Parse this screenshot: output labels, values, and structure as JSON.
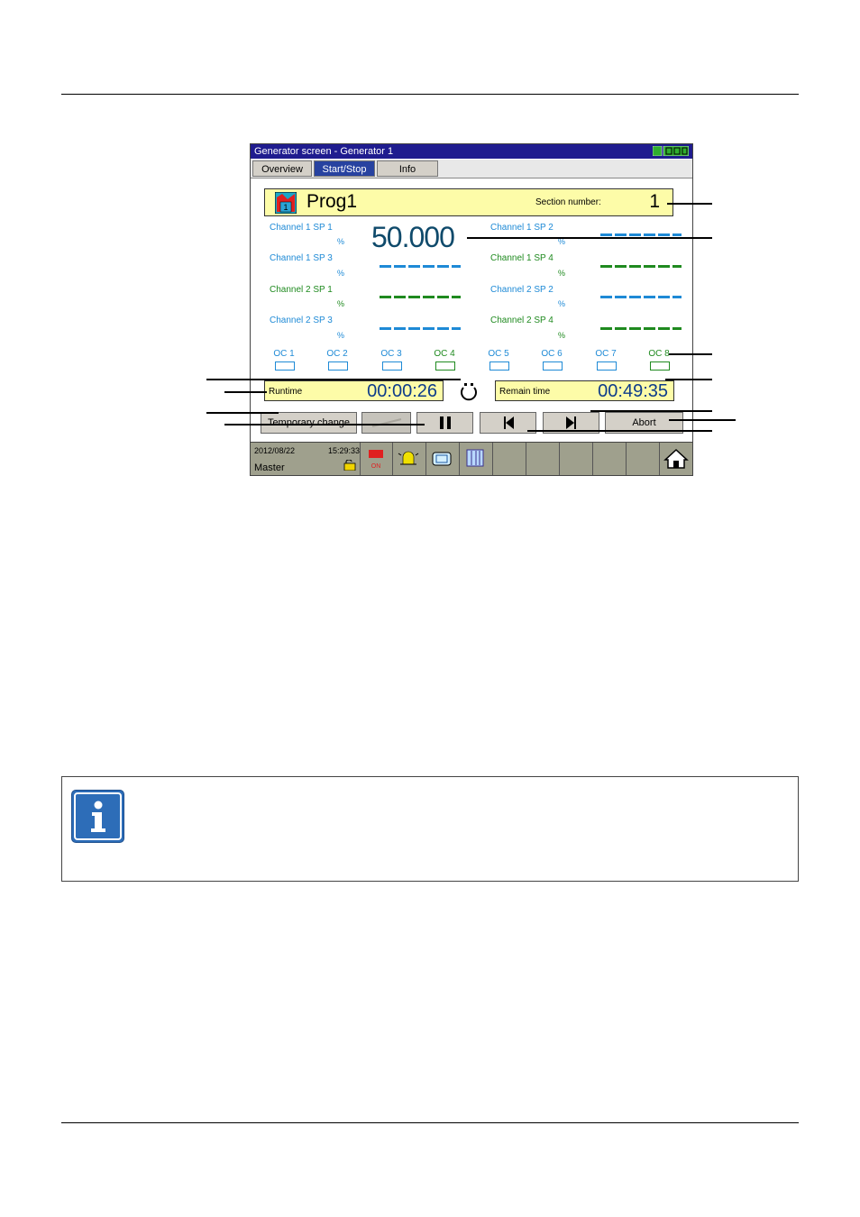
{
  "screen": {
    "title": "Generator screen - Generator 1",
    "tabs": [
      "Overview",
      "Start/Stop",
      "Info"
    ],
    "active_tab": "Start/Stop",
    "program": {
      "name": "Prog1",
      "section_label": "Section number:",
      "section_number": "1"
    },
    "channels": [
      {
        "label": "Channel 1  SP 1",
        "unit": "%",
        "value": "50.000"
      },
      {
        "label": "Channel 1  SP 2",
        "unit": "%",
        "value": "------"
      },
      {
        "label": "Channel 1  SP 3",
        "unit": "%",
        "value": "------"
      },
      {
        "label": "Channel 1  SP 4",
        "unit": "%",
        "value": "------"
      },
      {
        "label": "Channel 2  SP 1",
        "unit": "%",
        "value": "------"
      },
      {
        "label": "Channel 2  SP 2",
        "unit": "%",
        "value": "------"
      },
      {
        "label": "Channel 2  SP 3",
        "unit": "%",
        "value": "------"
      },
      {
        "label": "Channel 2  SP 4",
        "unit": "%",
        "value": "------"
      }
    ],
    "control_contacts": [
      "OC 1",
      "OC 2",
      "OC 3",
      "OC 4",
      "OC 5",
      "OC 6",
      "OC 7",
      "OC 8"
    ],
    "runtime": {
      "label": "Runtime",
      "value": "00:00:26"
    },
    "remain_time": {
      "label": "Remain time",
      "value": "00:49:35"
    },
    "buttons": {
      "temporary_change": "Temporary change",
      "abort": "Abort"
    },
    "statusbar": {
      "date": "2012/08/22",
      "time": "15:29:33",
      "user": "Master",
      "recording_label": "ON"
    },
    "icons": {
      "repeat": "repeat-cycle-icon",
      "pause": "pause-icon",
      "previous": "previous-section-icon",
      "next": "next-section-icon",
      "home": "home-icon",
      "alarm": "alarm-bell-icon",
      "lock": "lock-icon",
      "info": "info-icon"
    },
    "colors": {
      "title_bg": "#1f1c8f",
      "panel_yellow": "#fdfca8",
      "blue_channel": "#1e8ad6",
      "green_channel": "#1f8a1f",
      "bottombar": "#9fa08d"
    }
  }
}
